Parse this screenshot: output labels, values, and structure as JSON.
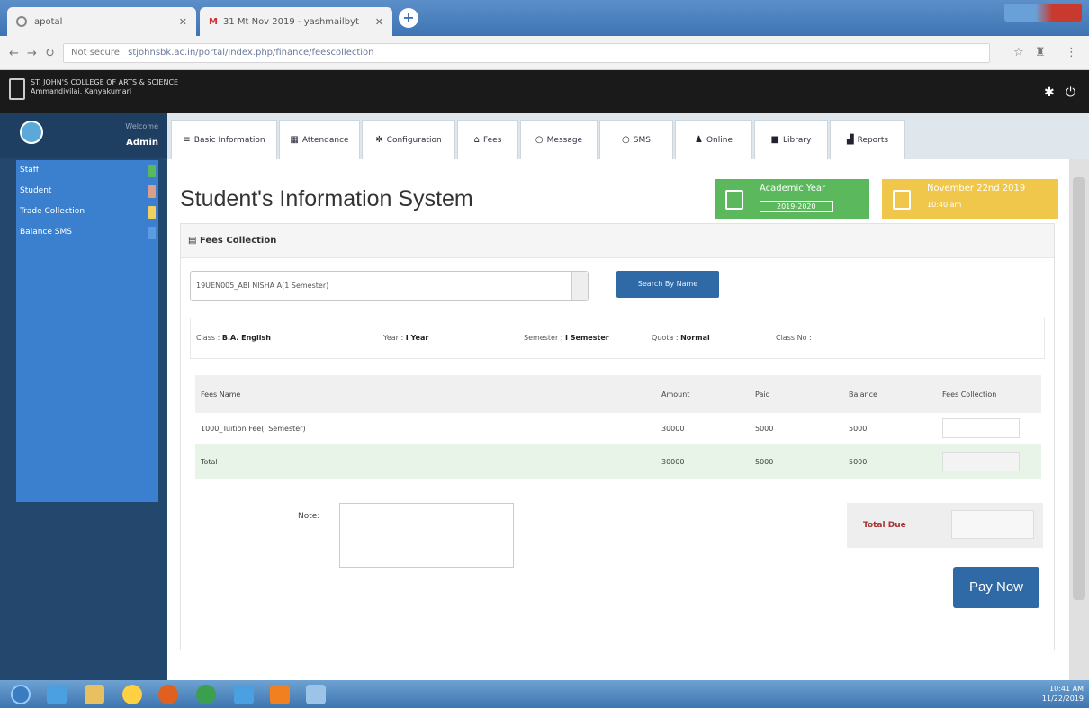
{
  "browser": {
    "tab1_title": "apotal",
    "tab2_title": "31 Mt Nov 2019 - yashmailbyt",
    "address_security": "Not secure",
    "address_url": "stjohnsbk.ac.in/portal/index.php/finance/feescollection"
  },
  "app": {
    "college_name_line1": "ST. JOHN'S COLLEGE OF ARTS & SCIENCE",
    "college_name_line2": "Ammandivilai, Kanyakumari"
  },
  "sidebar": {
    "welcome": "Welcome",
    "user": "Admin",
    "items": [
      {
        "label": "Staff",
        "badge_color": "#5cb85c"
      },
      {
        "label": "Student",
        "badge_color": "#d9a089"
      },
      {
        "label": "Trade Collection",
        "badge_color": "#f0d060"
      },
      {
        "label": "Balance SMS",
        "badge_color": "#3a80cf"
      }
    ]
  },
  "modules": [
    {
      "label": "Basic Information",
      "icon": "list-icon",
      "glyph": "≡"
    },
    {
      "label": "Attendance",
      "icon": "grid-icon",
      "glyph": "▦"
    },
    {
      "label": "Configuration",
      "icon": "gear-icon",
      "glyph": "✲"
    },
    {
      "label": "Fees",
      "icon": "bank-icon",
      "glyph": "⌂"
    },
    {
      "label": "Message",
      "icon": "chat-icon",
      "glyph": "○"
    },
    {
      "label": "SMS",
      "icon": "chat-icon",
      "glyph": "○"
    },
    {
      "label": "Online",
      "icon": "user-icon",
      "glyph": "♟"
    },
    {
      "label": "Library",
      "icon": "book-icon",
      "glyph": "■"
    },
    {
      "label": "Reports",
      "icon": "chart-icon",
      "glyph": "▟"
    }
  ],
  "page": {
    "title": "Student's Information System",
    "academic_year_label": "Academic Year",
    "academic_year_value": "2019-2020",
    "date_label": "November 22nd 2019",
    "date_sub": "10:40 am"
  },
  "fees": {
    "panel_title": "Fees Collection",
    "student_select": "19UEN005_ABI NISHA A(1 Semester)",
    "search_button": "Search By Name",
    "info": {
      "class_label": "Class :",
      "class_value": "B.A. English",
      "year_label": "Year :",
      "year_value": "I Year",
      "semester_label": "Semester :",
      "semester_value": "I Semester",
      "quota_label": "Quota :",
      "quota_value": "Normal",
      "classno_label": "Class No :",
      "classno_value": ""
    },
    "columns": [
      "Fees Name",
      "Amount",
      "Paid",
      "Balance",
      "Fees Collection"
    ],
    "rows": [
      {
        "name": "1000_Tuition Fee(I Semester)",
        "amount": "30000",
        "paid": "5000",
        "balance": "5000"
      }
    ],
    "total": {
      "name": "Total",
      "amount": "30000",
      "paid": "5000",
      "balance": "5000"
    },
    "note_label": "Note:",
    "total_due_label": "Total Due",
    "pay_button": "Pay Now"
  },
  "taskbar": {
    "time": "10:41 AM",
    "date": "11/22/2019"
  }
}
